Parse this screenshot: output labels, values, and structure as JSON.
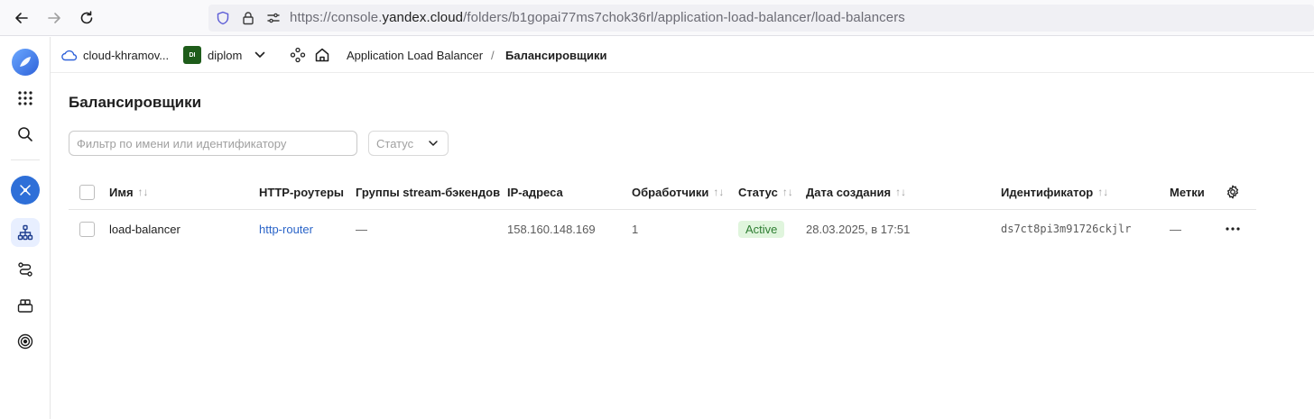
{
  "browser": {
    "url_prefix": "https://console.",
    "url_host": "yandex.cloud",
    "url_path": "/folders/b1gopai77ms7chok36rl/application-load-balancer/load-balancers"
  },
  "header": {
    "cloud_name": "cloud-khramov...",
    "folder_badge": "DI",
    "folder_name": "diplom",
    "breadcrumb_service": "Application Load Balancer",
    "breadcrumb_separator": "/",
    "breadcrumb_current": "Балансировщики"
  },
  "main": {
    "title": "Балансировщики",
    "filter_placeholder": "Фильтр по имени или идентификатору",
    "status_placeholder": "Статус"
  },
  "table": {
    "columns": {
      "name": "Имя",
      "routers": "HTTP-роутеры",
      "stream_groups": "Группы stream-бэкендов",
      "ip": "IP-адреса",
      "listeners": "Обработчики",
      "status": "Статус",
      "created": "Дата создания",
      "id": "Идентификатор",
      "labels": "Метки"
    },
    "sort_glyph": "↑↓",
    "rows": [
      {
        "name": "load-balancer",
        "routers": "http-router",
        "stream_groups": "—",
        "ip": "158.160.148.169",
        "listeners": "1",
        "status": "Active",
        "created": "28.03.2025, в 17:51",
        "id": "ds7ct8pi3m91726ckjlr",
        "labels": "—"
      }
    ]
  },
  "colors": {
    "accent": "#2a64c8",
    "status_active_bg": "#e0f5dd",
    "status_active_text": "#2e7d32",
    "folder_badge_bg": "#1e5c1a"
  },
  "icons": {
    "back": "arrow-left-icon",
    "forward": "arrow-right-icon",
    "reload": "reload-icon",
    "shield": "shield-icon",
    "lock": "lock-icon",
    "permissions": "permissions-icon",
    "logo": "yandex-cloud-logo-icon",
    "services": "grid-icon",
    "search": "search-icon",
    "network": "network-icon",
    "load_balancer": "load-balancer-icon",
    "routes": "routes-icon",
    "backend_groups": "backend-groups-icon",
    "target_groups": "target-groups-icon",
    "settings": "gear-icon",
    "more": "more-icon"
  }
}
